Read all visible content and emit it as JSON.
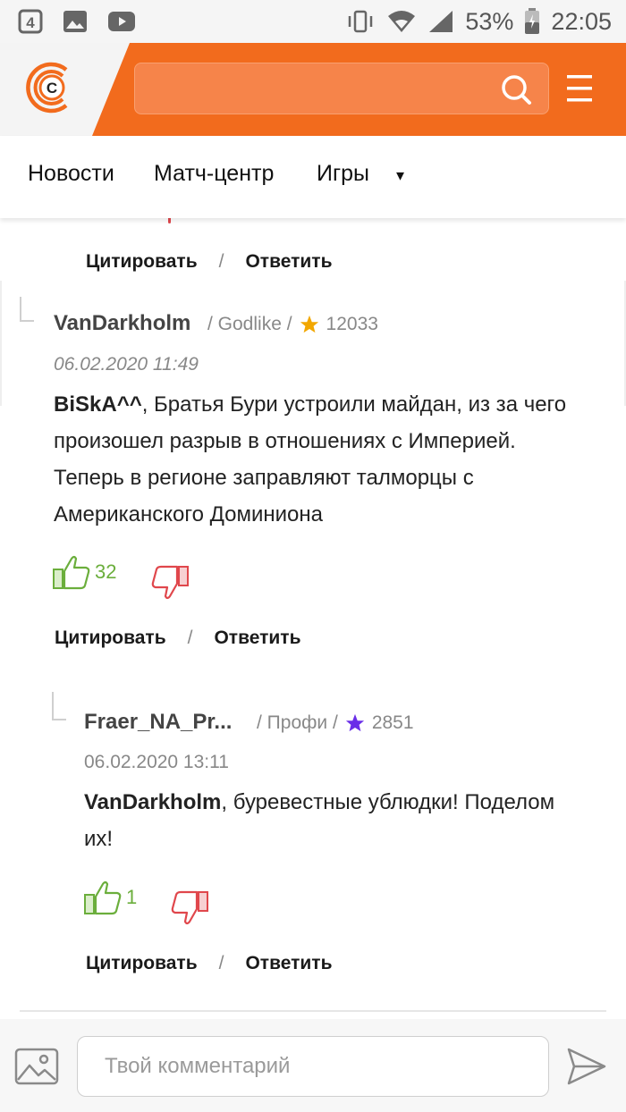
{
  "status_bar": {
    "battery": "53%",
    "time": "22:05",
    "icons": [
      "notification-4-icon",
      "image-icon",
      "youtube-icon",
      "vibrate-icon",
      "wifi-icon",
      "signal-icon",
      "battery-icon"
    ]
  },
  "header": {
    "logo": "C",
    "search_placeholder": "",
    "search_icon": "search-icon",
    "menu_icon": "hamburger-menu-icon",
    "brand_color": "#f26b1d"
  },
  "nav": {
    "items": [
      "Новости",
      "Матч-центр",
      "Игры"
    ],
    "more_caret": "▾"
  },
  "actions": {
    "quote": "Цитировать",
    "separator": "/",
    "reply": "Ответить"
  },
  "comments": [
    {
      "author": "VanDarkholm",
      "rank": "/ Godlike /",
      "rating": "12033",
      "star_color": "#f2a700",
      "date": "06.02.2020 11:49",
      "reply_to": "BiSkA^^",
      "text": ", Братья Бури устроили майдан, из за чего произошел разрыв в отношениях с Империей. Теперь в регионе заправляют талморцы с Американского Доминиона",
      "likes": "32"
    },
    {
      "author": "Fraer_NA_Pr...",
      "rank": "/ Профи /",
      "rating": "2851",
      "star_color": "#6a2ee8",
      "date": "06.02.2020 13:11",
      "reply_to": "VanDarkholm",
      "text": ", буревестные ублюдки! Поделом их!",
      "likes": "1"
    }
  ],
  "composer": {
    "placeholder": "Твой комментарий",
    "attach_icon": "image-attach-icon",
    "send_icon": "send-icon"
  },
  "colors": {
    "like": "#6bae3c",
    "dislike": "#e0474c"
  }
}
